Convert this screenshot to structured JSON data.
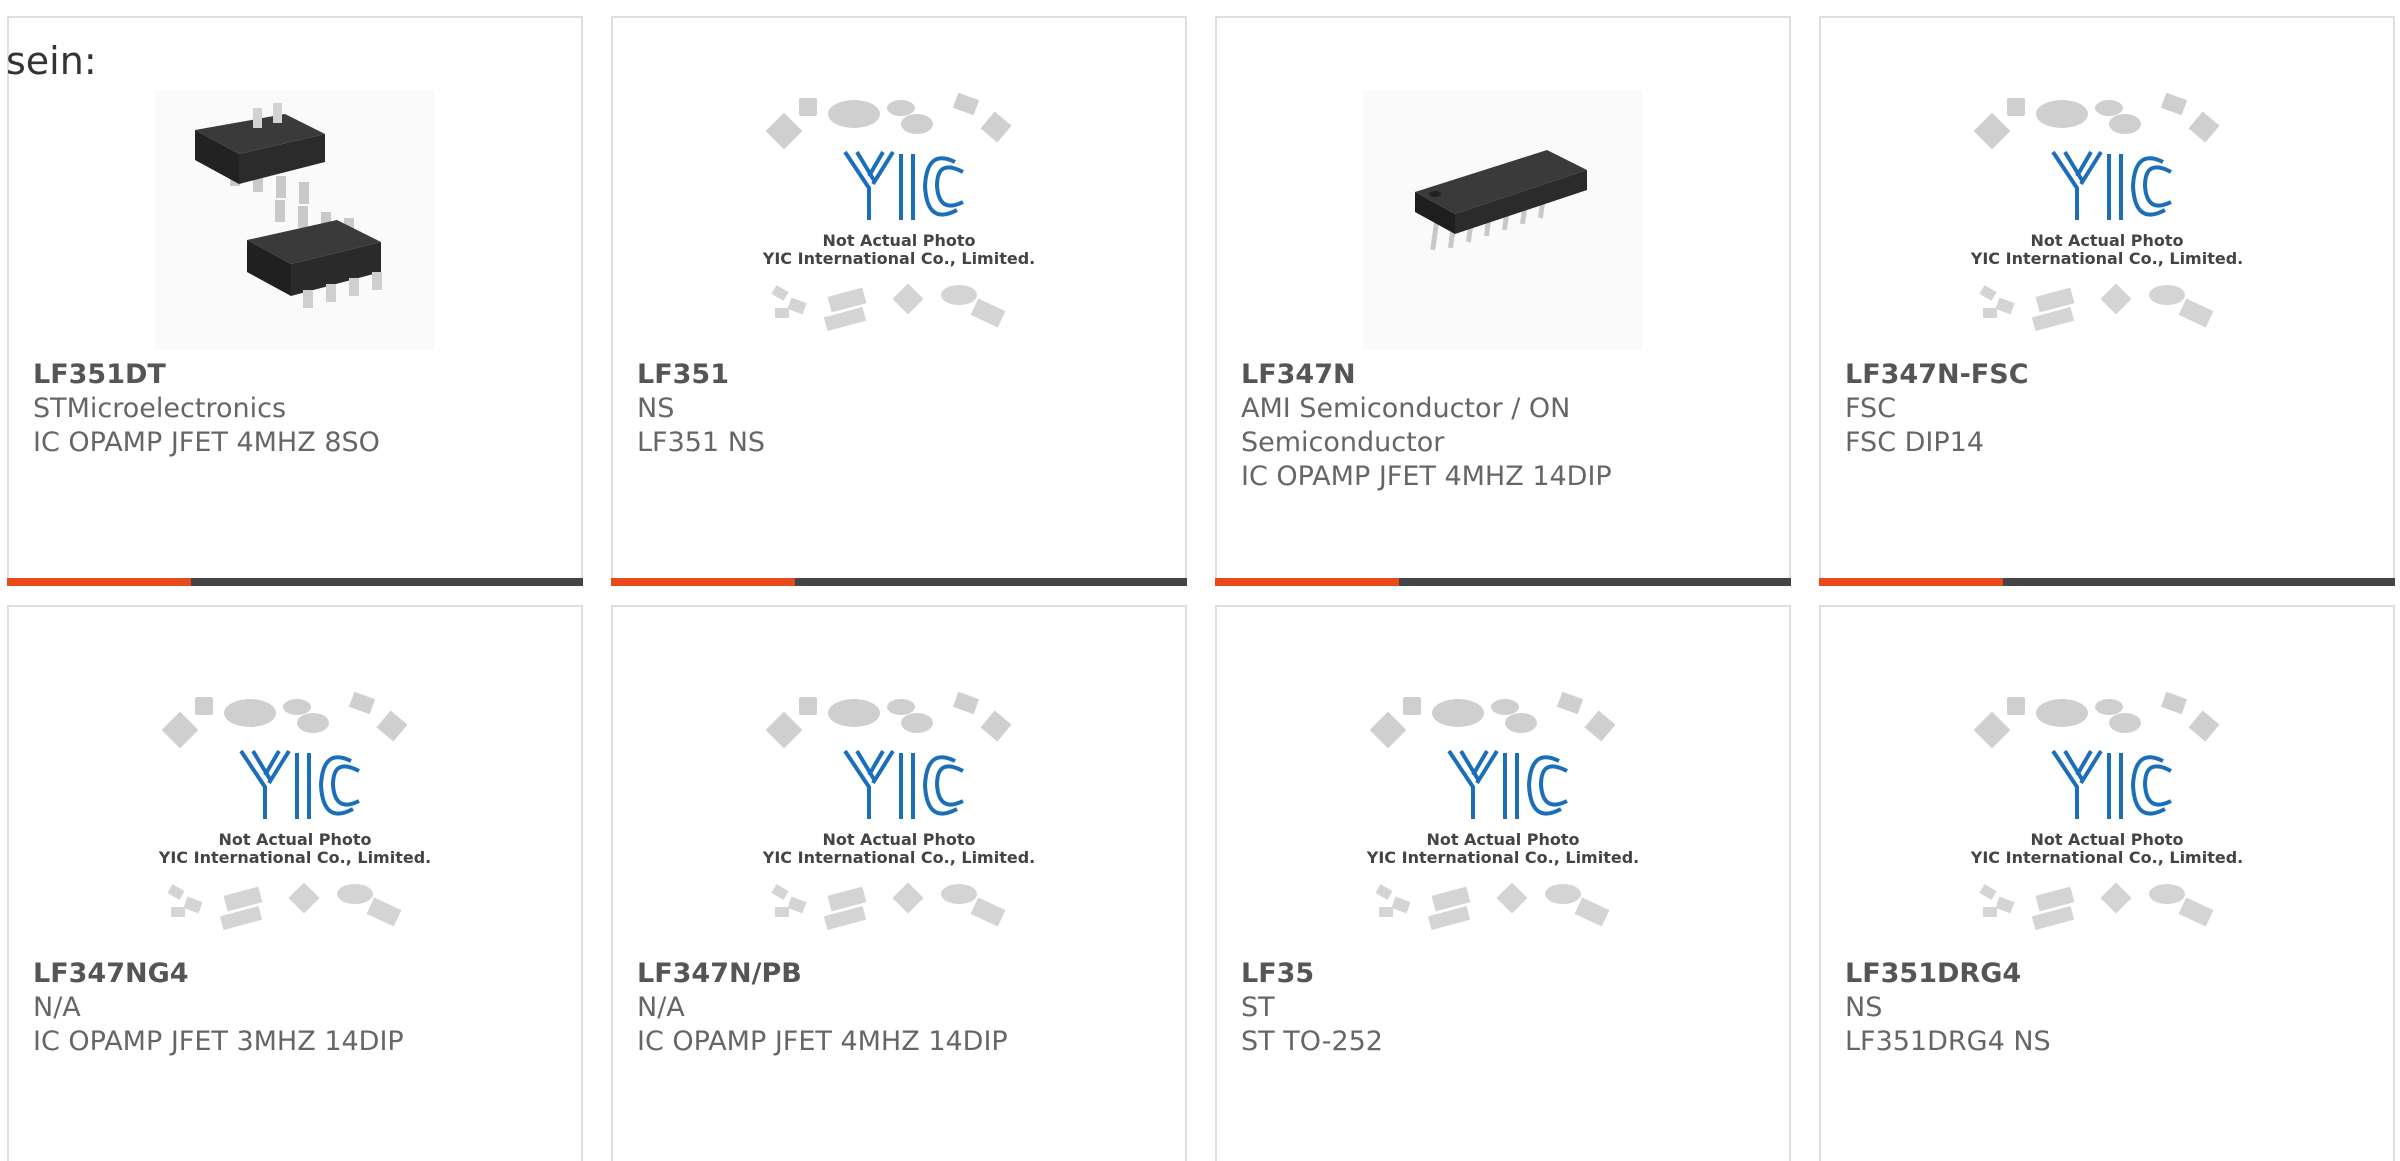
{
  "intro_text": "sein:",
  "placeholder": {
    "line1": "Not Actual Photo",
    "line2": "YIC International Co., Limited.",
    "logo": "YIC"
  },
  "products": [
    {
      "part": "LF351DT",
      "maker": "STMicroelectronics",
      "desc": "IC OPAMP JFET 4MHZ 8SO",
      "image": "soic-8-chip-icon"
    },
    {
      "part": "LF351",
      "maker": "NS",
      "desc": "LF351 NS",
      "image": "placeholder"
    },
    {
      "part": "LF347N",
      "maker": "AMI Semiconductor / ON Semiconductor",
      "desc": "IC OPAMP JFET 4MHZ 14DIP",
      "image": "dip-14-chip-icon"
    },
    {
      "part": "LF347N-FSC",
      "maker": "FSC",
      "desc": "FSC DIP14",
      "image": "placeholder"
    },
    {
      "part": "LF347NG4",
      "maker": "N/A",
      "desc": "IC OPAMP JFET 3MHZ 14DIP",
      "image": "placeholder"
    },
    {
      "part": "LF347N/PB",
      "maker": "N/A",
      "desc": "IC OPAMP JFET 4MHZ 14DIP",
      "image": "placeholder"
    },
    {
      "part": "LF35",
      "maker": "ST",
      "desc": "ST TO-252",
      "image": "placeholder"
    },
    {
      "part": "LF351DRG4",
      "maker": "NS",
      "desc": "LF351DRG4 NS",
      "image": "placeholder"
    }
  ],
  "colors": {
    "accent": "#e84a1c",
    "bar": "#444444",
    "logo_blue": "#1a6fb8"
  }
}
